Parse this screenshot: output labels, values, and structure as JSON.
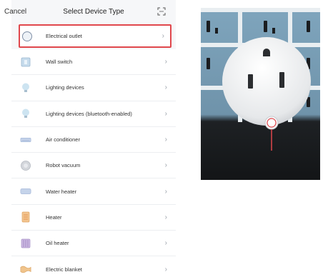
{
  "header": {
    "cancel_label": "Cancel",
    "title": "Select Device Type"
  },
  "devices": [
    {
      "label": "Electrical outlet",
      "icon": "outlet-icon",
      "selected": true
    },
    {
      "label": "Wall switch",
      "icon": "wall-switch-icon"
    },
    {
      "label": "Lighting devices",
      "icon": "bulb-icon"
    },
    {
      "label": "Lighting devices (bluetooth-enabled)",
      "icon": "bulb-icon"
    },
    {
      "label": "Air conditioner",
      "icon": "air-conditioner-icon"
    },
    {
      "label": "Robot vacuum",
      "icon": "robot-vacuum-icon"
    },
    {
      "label": "Water heater",
      "icon": "water-heater-icon"
    },
    {
      "label": "Heater",
      "icon": "heater-icon"
    },
    {
      "label": "Oil heater",
      "icon": "oil-heater-icon"
    },
    {
      "label": "Electric blanket",
      "icon": "electric-blanket-icon"
    }
  ],
  "colors": {
    "highlight": "#e0474c",
    "tile_blue": "#7fa5bd",
    "icon_blue": "#9fb4d6"
  }
}
